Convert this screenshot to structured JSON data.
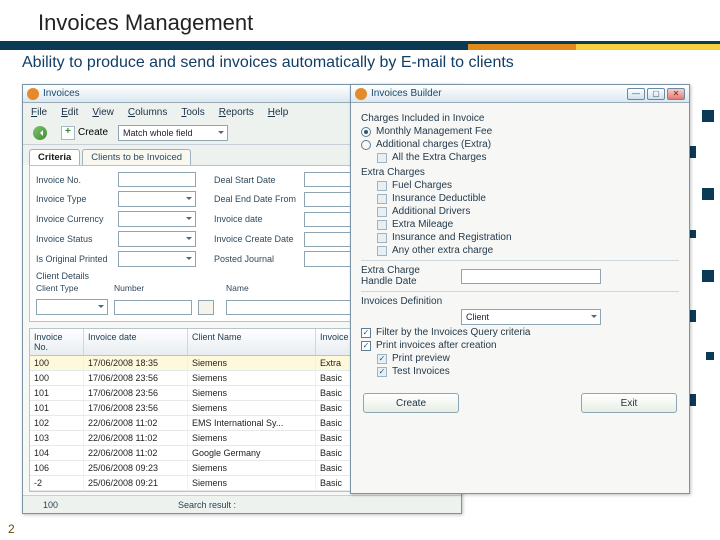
{
  "slide": {
    "title": "Invoices Management",
    "subtitle": "Ability to produce and send invoices automatically by E-mail to clients",
    "page_marker": "2"
  },
  "invoices_win": {
    "title": "Invoices",
    "menu": [
      "File",
      "Edit",
      "View",
      "Columns",
      "Tools",
      "Reports",
      "Help"
    ],
    "toolbar": {
      "create": "Create",
      "match_field": "Match whole field"
    },
    "tabs": [
      "Criteria",
      "Clients to be Invoiced"
    ],
    "form_labels": {
      "invoice_no": "Invoice No.",
      "invoice_type": "Invoice Type",
      "invoice_currency": "Invoice Currency",
      "invoice_status": "Invoice Status",
      "is_original_printed": "Is Original Printed",
      "deal_start_date": "Deal Start Date",
      "deal_end_date_from": "Deal End Date From",
      "invoice_date": "Invoice date",
      "invoice_create_date": "Invoice Create Date",
      "posted_journal": "Posted Journal",
      "client_details": "Client Details",
      "client_type": "Client Type",
      "number": "Number",
      "name": "Name"
    },
    "grid": {
      "headers": [
        "Invoice No.",
        "Invoice date",
        "Client Name",
        "Invoice Type"
      ],
      "rows": [
        {
          "no": "100",
          "date": "17/06/2008 18:35",
          "client": "Siemens",
          "type": "Extra"
        },
        {
          "no": "100",
          "date": "17/06/2008 23:56",
          "client": "Siemens",
          "type": "Basic"
        },
        {
          "no": "101",
          "date": "17/06/2008 23:56",
          "client": "Siemens",
          "type": "Basic"
        },
        {
          "no": "101",
          "date": "17/06/2008 23:56",
          "client": "Siemens",
          "type": "Basic"
        },
        {
          "no": "102",
          "date": "22/06/2008 11:02",
          "client": "EMS International Sy...",
          "type": "Basic"
        },
        {
          "no": "103",
          "date": "22/06/2008 11:02",
          "client": "Siemens",
          "type": "Basic"
        },
        {
          "no": "104",
          "date": "22/06/2008 11:02",
          "client": "Google Germany",
          "type": "Basic"
        },
        {
          "no": "106",
          "date": "25/06/2008 09:23",
          "client": "Siemens",
          "type": "Basic"
        },
        {
          "no": "-2",
          "date": "25/06/2008 09:21",
          "client": "Siemens",
          "type": "Basic"
        }
      ]
    },
    "status": {
      "count": "100",
      "label": "Search result :"
    }
  },
  "builder_win": {
    "title": "Invoices Builder",
    "section_charges": "Charges Included in Invoice",
    "opt_monthly": "Monthly Management Fee",
    "opt_additional": "Additional charges (Extra)",
    "chk_all_extra": "All the Extra Charges",
    "extra_title": "Extra Charges",
    "extras": [
      "Fuel Charges",
      "Insurance Deductible",
      "Additional Drivers",
      "Extra Mileage",
      "Insurance and Registration",
      "Any other extra charge"
    ],
    "extra_handle_date": "Extra Charge Handle Date",
    "inv_def": "Invoices Definition",
    "inv_def_value": "Client",
    "chk_filter": "Filter by the Invoices Query criteria",
    "chk_print_after": "Print invoices after creation",
    "chk_preview": "Print preview",
    "chk_test": "Test Invoices",
    "btn_create": "Create",
    "btn_exit": "Exit"
  }
}
